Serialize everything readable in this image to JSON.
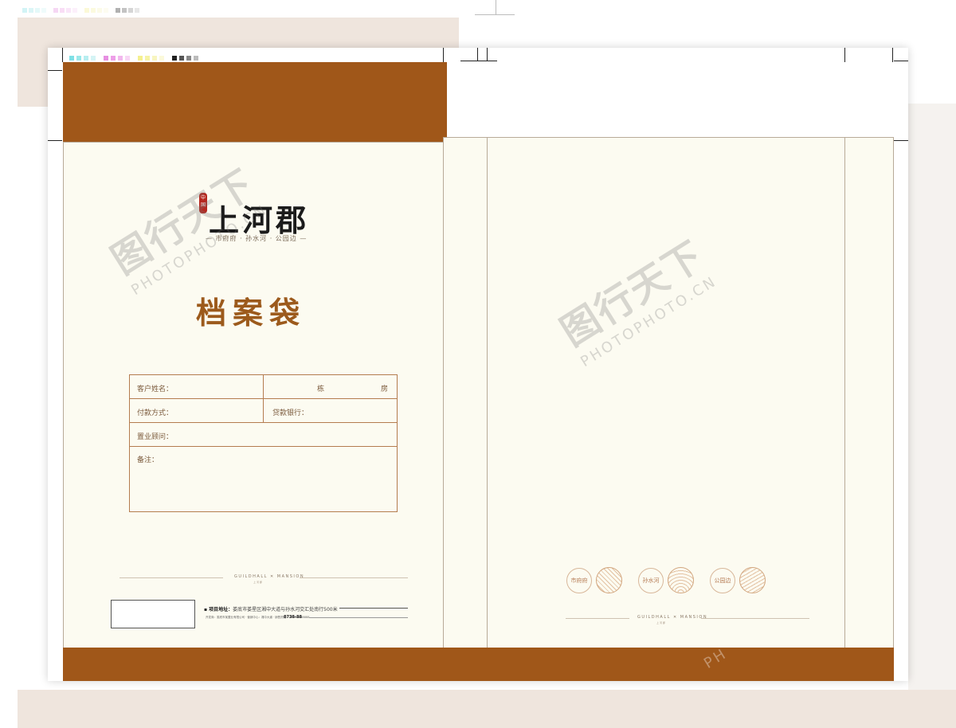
{
  "front": {
    "logo_seal": "中国",
    "logo": "上河郡",
    "slogan": "— 市府府 · 孙水河 · 公园边 —",
    "title": "档案袋",
    "form": {
      "customer_label": "客户姓名：",
      "building_label": "栋",
      "unit_label": "房",
      "payment_label": "付款方式：",
      "bank_label": "贷款银行：",
      "consultant_label": "置业顾问：",
      "notes_label": "备注："
    },
    "mini_brand": "GUILDHALL ✕ MANSION",
    "mini_brand_sub": "上河郡",
    "address_label": "项目地址：",
    "address": "娄底市娄星区湘中大道与孙水河交汇处南行500米",
    "fine_print": "开发商：娄底市某置业有限公司 · 营销中心：湘中大道 · 销售热线：0738-8888888",
    "hotline": "0738-88"
  },
  "back": {
    "badges": [
      "市府府",
      "孙水河",
      "公园边"
    ],
    "mini_brand": "GUILDHALL ✕ MANSION",
    "mini_brand_sub": "上河郡"
  },
  "watermark": {
    "cn": "图行天下",
    "en": "PHOTOPHOTO.CN",
    "en_partial": "PH"
  },
  "colors": {
    "brand_brown": "#a05719",
    "panel_cream": "#fcfbf1",
    "form_line": "#b47c4f",
    "title_brown": "#9c5a1c"
  },
  "color_bar": {
    "swatches": [
      "#7fe0e6",
      "#9be8ea",
      "#b7eef0",
      "#d4f4f5",
      "#e68fe1",
      "#ee9fe8",
      "#f2b8ee",
      "#f8d6f5",
      "#f5f08f",
      "#f6f3a5",
      "#f8f5c0",
      "#fbf9da",
      "#222222",
      "#555555",
      "#888888",
      "#bbbbbb"
    ]
  }
}
